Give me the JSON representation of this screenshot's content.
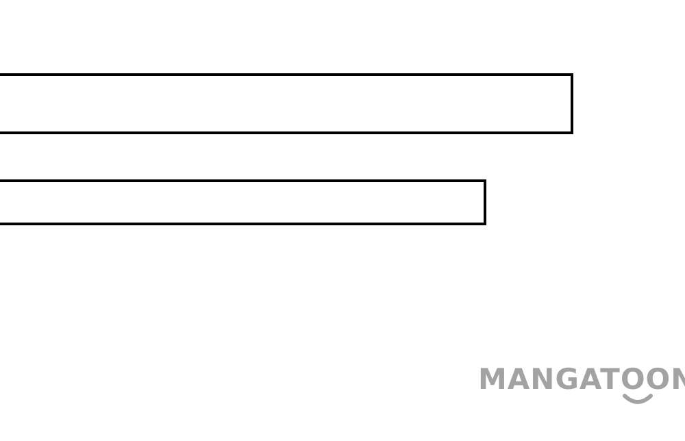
{
  "panels": [
    {
      "id": "panel-1"
    },
    {
      "id": "panel-2"
    }
  ],
  "watermark": {
    "text": "MANGATOON",
    "color": "#a3a3a3"
  },
  "colors": {
    "background": "#ffffff",
    "border": "#000000"
  }
}
